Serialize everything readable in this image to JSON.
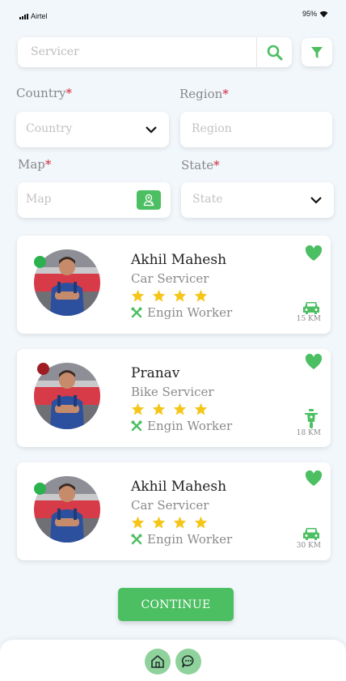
{
  "status_bar": {
    "carrier": "Airtel",
    "battery": "95%"
  },
  "search": {
    "placeholder": "Servicer"
  },
  "fields": {
    "country": {
      "label": "Country",
      "required": "*",
      "placeholder": "Country"
    },
    "region": {
      "label": "Region",
      "required": "*",
      "placeholder": "Region"
    },
    "map": {
      "label": "Map",
      "required": "*",
      "placeholder": "Map"
    },
    "state": {
      "label": "State",
      "required": "*",
      "placeholder": "State"
    }
  },
  "workers": [
    {
      "name": "Akhil Mahesh",
      "role": "Car Servicer",
      "rating": 4,
      "skill": "Engin Worker",
      "distance": "15 KM",
      "status": "online",
      "status_color": "#2bb14e",
      "vehicle_icon": "car-icon",
      "favorite": true
    },
    {
      "name": "Pranav",
      "role": "Bike Servicer",
      "rating": 4,
      "skill": "Engin Worker",
      "distance": "18 KM",
      "status": "offline",
      "status_color": "#9e1c22",
      "vehicle_icon": "scooter-icon",
      "favorite": true
    },
    {
      "name": "Akhil Mahesh",
      "role": "Car Servicer",
      "rating": 4,
      "skill": "Engin Worker",
      "distance": "30 KM",
      "status": "online",
      "status_color": "#2bb14e",
      "vehicle_icon": "car-icon",
      "favorite": true
    }
  ],
  "continue_label": "CONTINUE",
  "nav": {
    "home_icon": "home-icon",
    "chat_icon": "chat-icon"
  },
  "colors": {
    "accent": "#4cbf62",
    "star": "#f5c518",
    "required": "#d0293a",
    "background": "#f2f7fb"
  }
}
